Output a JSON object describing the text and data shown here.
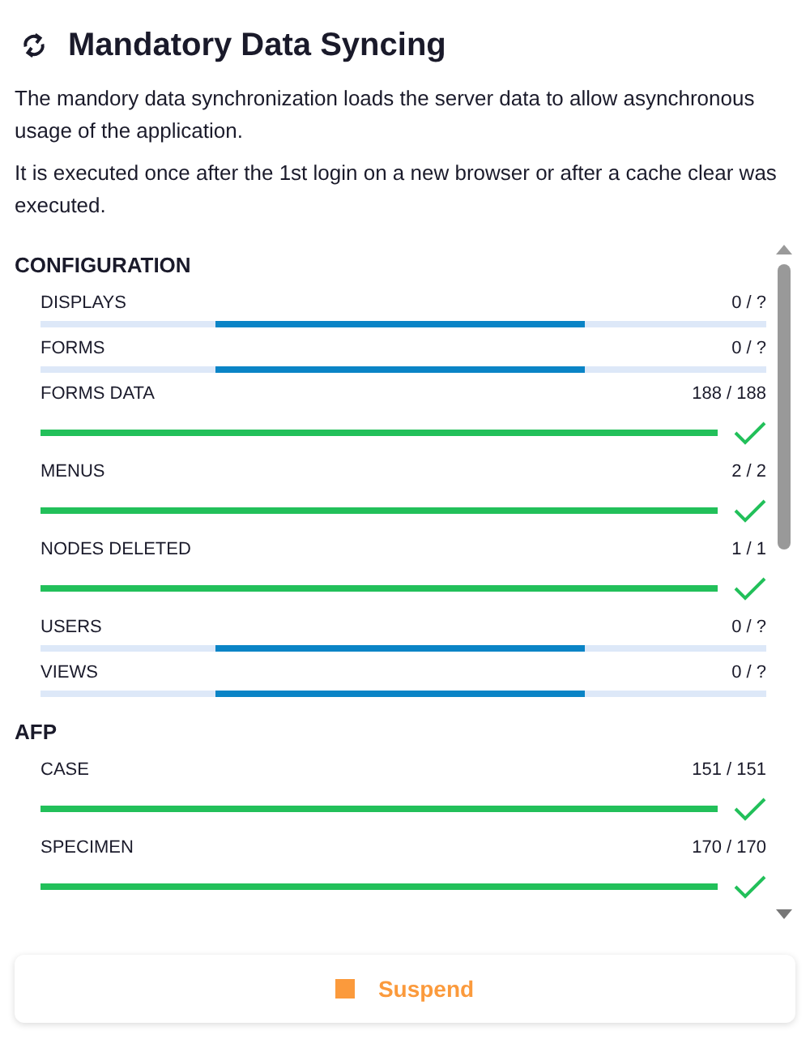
{
  "header": {
    "title": "Mandatory Data Syncing"
  },
  "description": [
    "The mandory data synchronization loads the server data to allow asynchronous usage of the application.",
    "It is executed once after the 1st login on a new browser or after a cache clear was executed."
  ],
  "sections": [
    {
      "title": "CONFIGURATION",
      "items": [
        {
          "label": "DISPLAYS",
          "count": "0 / ?",
          "kind": "indeterminate"
        },
        {
          "label": "FORMS",
          "count": "0 / ?",
          "kind": "indeterminate"
        },
        {
          "label": "FORMS DATA",
          "count": "188 / 188",
          "kind": "complete",
          "level": 1
        },
        {
          "label": "MENUS",
          "count": "2 / 2",
          "kind": "complete",
          "level": 1
        },
        {
          "label": "NODES DELETED",
          "count": "1 / 1",
          "kind": "complete",
          "level": 1
        },
        {
          "label": "USERS",
          "count": "0 / ?",
          "kind": "indeterminate"
        },
        {
          "label": "VIEWS",
          "count": "0 / ?",
          "kind": "indeterminate"
        }
      ]
    },
    {
      "title": "AFP",
      "items": [
        {
          "label": "CASE",
          "count": "151 / 151",
          "kind": "complete",
          "level": 1
        },
        {
          "label": "SPECIMEN",
          "count": "170 / 170",
          "kind": "complete",
          "level": 1
        }
      ]
    }
  ],
  "suspend_button": {
    "label": "Suspend"
  }
}
